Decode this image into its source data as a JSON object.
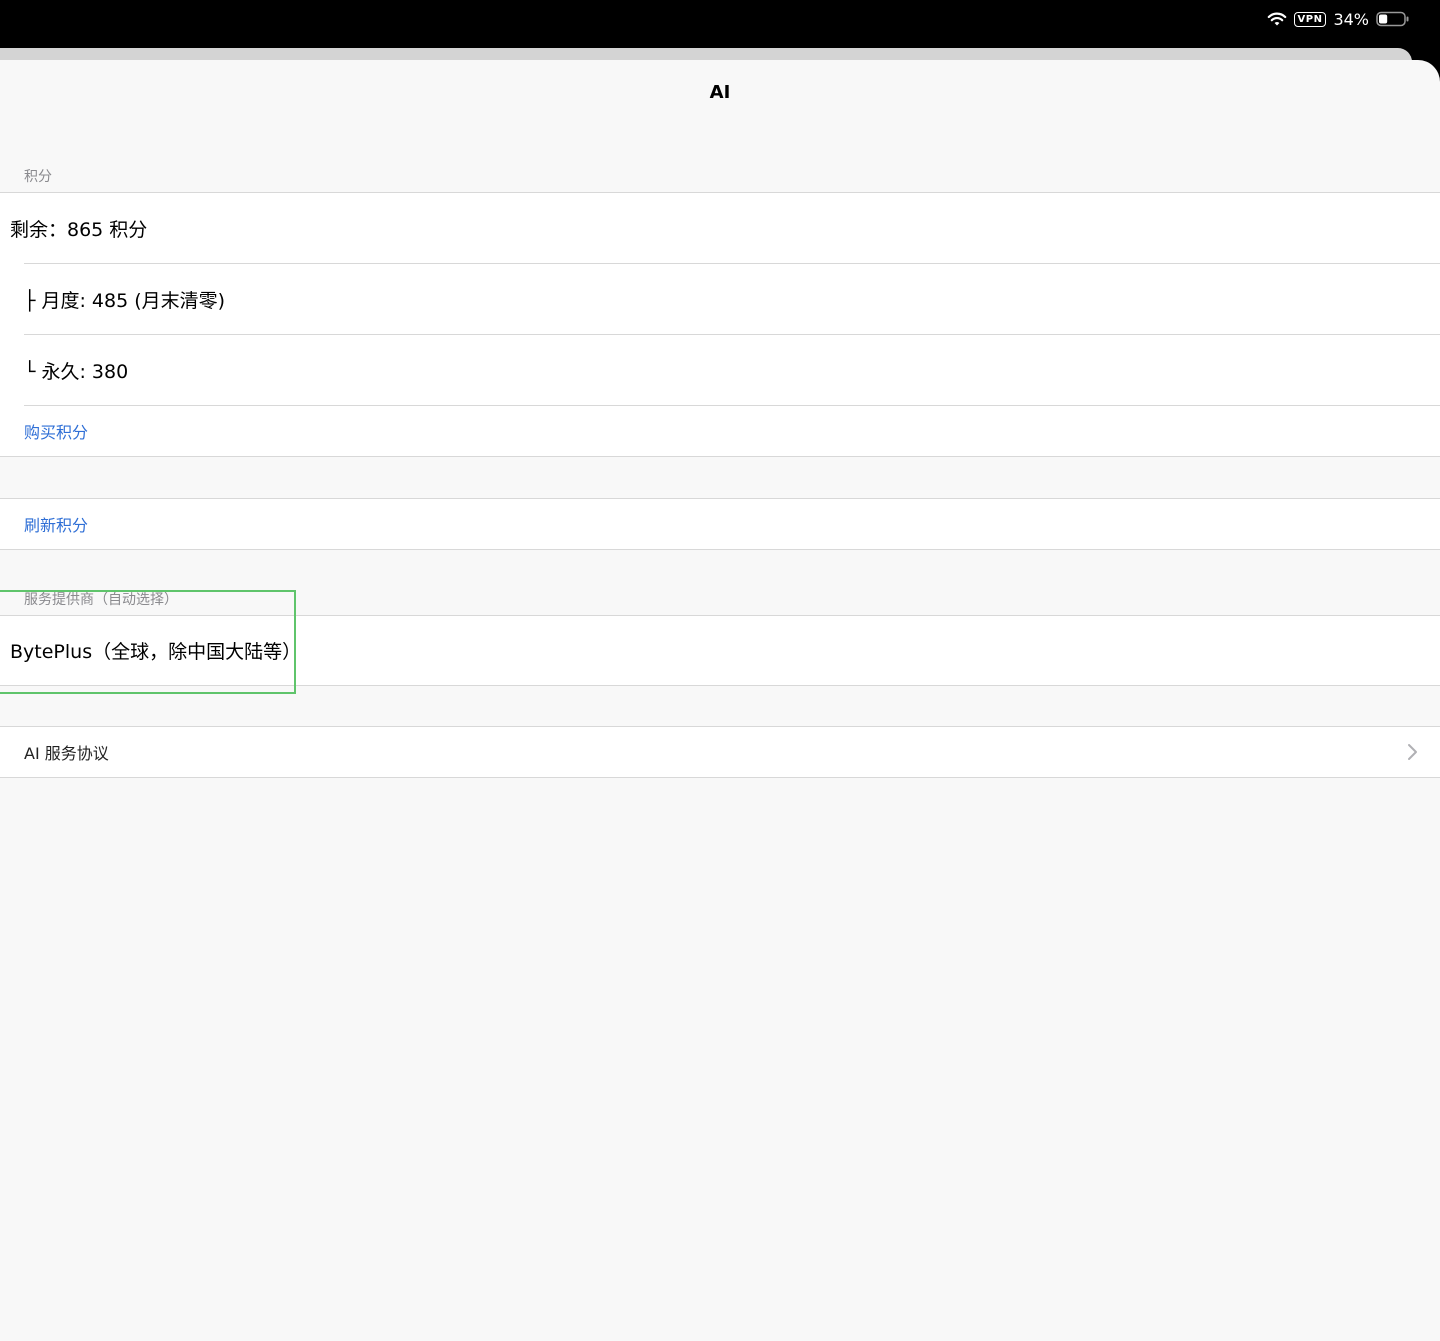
{
  "status_bar": {
    "vpn_label": "VPN",
    "battery_percent": "34%",
    "battery_level": 0.34
  },
  "nav": {
    "title": "AI"
  },
  "credits_section": {
    "header": "积分",
    "remaining": "剩余：865 积分",
    "monthly": "├ 月度: 485 (月末清零)",
    "permanent": "└ 永久: 380",
    "buy_link": "购买积分"
  },
  "refresh_section": {
    "refresh_link": "刷新积分"
  },
  "provider_section": {
    "header": "服务提供商（自动选择）",
    "provider": "BytePlus（全球，除中国大陆等）"
  },
  "agreement_section": {
    "label": "AI 服务协议"
  },
  "colors": {
    "accent": "#2f6fd6",
    "highlight": "#5fc46b",
    "background": "#f8f8f8"
  }
}
